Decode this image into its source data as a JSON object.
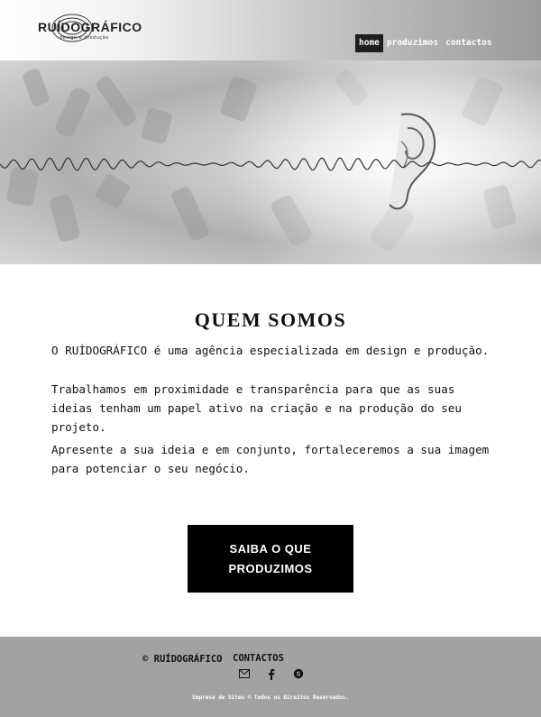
{
  "header": {
    "logo_text": "RUÍDOGRÁFICO",
    "logo_tagline": "design e produção",
    "nav": [
      {
        "label": "home",
        "active": true
      },
      {
        "label": "produzimos",
        "active": false
      },
      {
        "label": "contactos",
        "active": false
      }
    ]
  },
  "hero": {
    "icon": "ear-sound-wave-illustration"
  },
  "main": {
    "title": "QUEM SOMOS",
    "paragraphs": [
      "O RUÍDOGRÁFICO é uma agência especializada em design e produção.",
      "Trabalhamos em proximidade e transparência para que as suas ideias tenham um papel ativo na criação e na produção do seu projeto.",
      "Apresente a sua ideia e em conjunto, fortaleceremos a sua imagem para potenciar o seu negócio."
    ],
    "cta_label": "SAIBA O QUE PRODUZIMOS"
  },
  "footer": {
    "copyright": "© RUÍDOGRÁFICO",
    "contacts_title": "CONTACTOS",
    "icons": [
      "envelope-icon",
      "facebook-icon",
      "skype-icon"
    ],
    "legal": "Empresa de Sites © Todos os Direitos Reservados."
  },
  "colors": {
    "nav_active_bg": "#1e1e1e",
    "cta_bg": "#000000",
    "footer_bg": "#a2a2a2"
  }
}
